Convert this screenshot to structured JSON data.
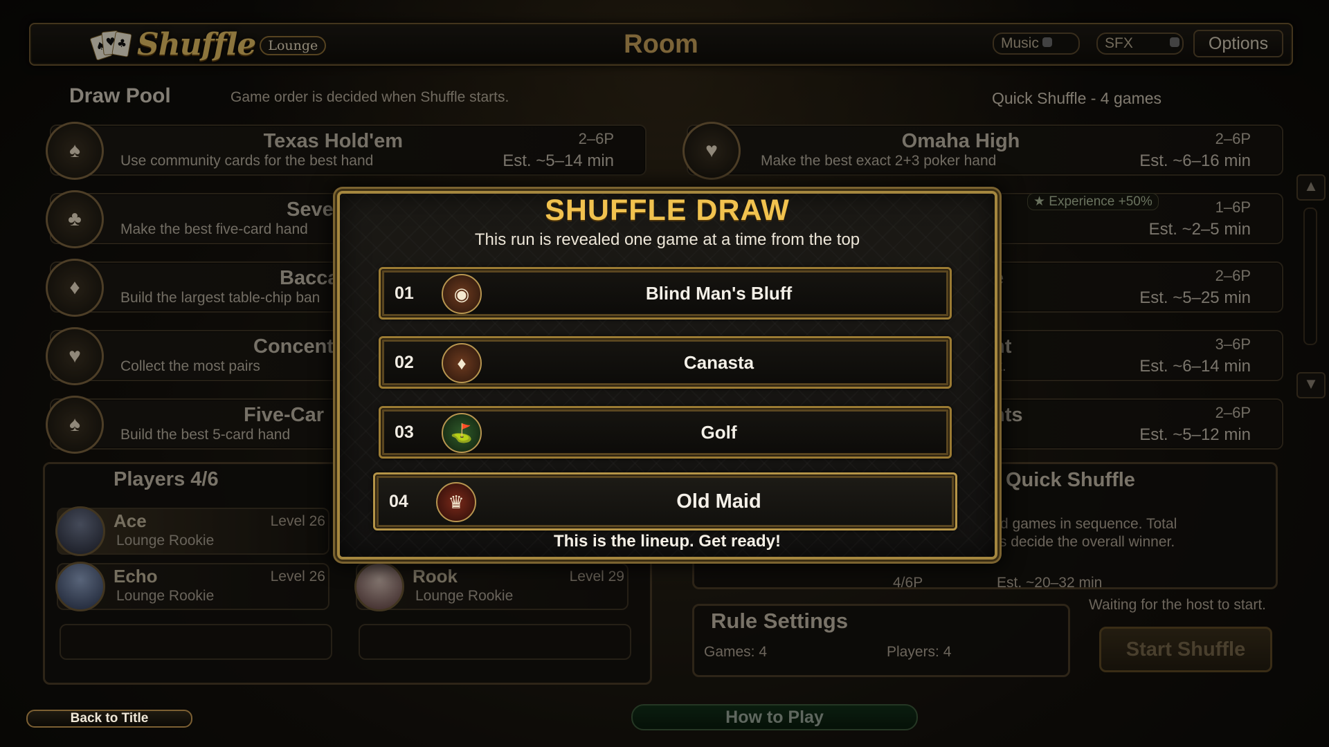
{
  "header": {
    "logo_text": "Shuffle",
    "logo_sub": "Lounge",
    "title": "Room",
    "music_label": "Music",
    "sfx_label": "SFX",
    "options_label": "Options"
  },
  "pool": {
    "title": "Draw Pool",
    "subtitle": "Game order is decided when Shuffle starts.",
    "mode_label": "Quick Shuffle - 4 games",
    "games_left": [
      {
        "name": "Texas Hold'em",
        "desc": "Use community cards for the best hand",
        "players": "2–6P",
        "est": "Est. ~5–14 min",
        "icon": "♠"
      },
      {
        "name": "Seven-Car",
        "desc": "Make the best five-card hand",
        "players": "",
        "est": "",
        "icon": "♣"
      },
      {
        "name": "Bacca",
        "desc": "Build the largest table-chip ban",
        "players": "",
        "est": "",
        "icon": "♦"
      },
      {
        "name": "Concent",
        "desc": "Collect the most pairs",
        "players": "",
        "est": "",
        "icon": "♥"
      },
      {
        "name": "Five-Car",
        "desc": "Build the best 5-card hand",
        "players": "",
        "est": "",
        "icon": "♠"
      }
    ],
    "games_right": [
      {
        "name": "Omaha High",
        "desc": "Make the best exact 2+3 poker hand",
        "players": "2–6P",
        "est": "Est. ~6–16 min",
        "icon": "♥"
      },
      {
        "name": "",
        "desc": "",
        "players": "1–6P",
        "est": "Est. ~2–5 min",
        "badge": "★ Experience +50%",
        "icon": ""
      },
      {
        "name": "e",
        "desc": "",
        "players": "2–6P",
        "est": "Est. ~5–25 min",
        "icon": ""
      },
      {
        "name": "nt",
        "desc": "t.",
        "players": "3–6P",
        "est": "Est. ~6–14 min",
        "icon": ""
      },
      {
        "name": "hts",
        "desc": "",
        "players": "2–6P",
        "est": "Est. ~5–12 min",
        "icon": ""
      }
    ]
  },
  "players": {
    "title": "Players 4/6",
    "list": [
      {
        "name": "Ace",
        "level": "Level 26",
        "title": "Lounge Rookie"
      },
      {
        "name": "Echo",
        "level": "Level 26",
        "title": "Lounge Rookie"
      },
      {
        "name": "Rook",
        "level": "Level 29",
        "title": "Lounge Rookie"
      }
    ]
  },
  "quick_shuffle": {
    "title": "Quick Shuffle",
    "text_line1": "ened games in sequence. Total",
    "text_line2": "oints decide the overall winner.",
    "players": "4/6P",
    "est": "Est. ~20–32 min",
    "waiting": "Waiting for the host to start."
  },
  "rules": {
    "title": "Rule Settings",
    "games": "Games: 4",
    "players": "Players: 4"
  },
  "buttons": {
    "start": "Start Shuffle",
    "back": "Back to Title",
    "how": "How to Play"
  },
  "modal": {
    "title": "SHUFFLE DRAW",
    "subtitle": "This run is revealed one game at a time from the top",
    "rows": [
      {
        "num": "01",
        "name": "Blind Man's Bluff",
        "icon": "◉"
      },
      {
        "num": "02",
        "name": "Canasta",
        "icon": "♦"
      },
      {
        "num": "03",
        "name": "Golf",
        "icon": "⛳"
      },
      {
        "num": "04",
        "name": "Old Maid",
        "icon": "♛"
      }
    ],
    "footer": "This is the lineup. Get ready!"
  }
}
